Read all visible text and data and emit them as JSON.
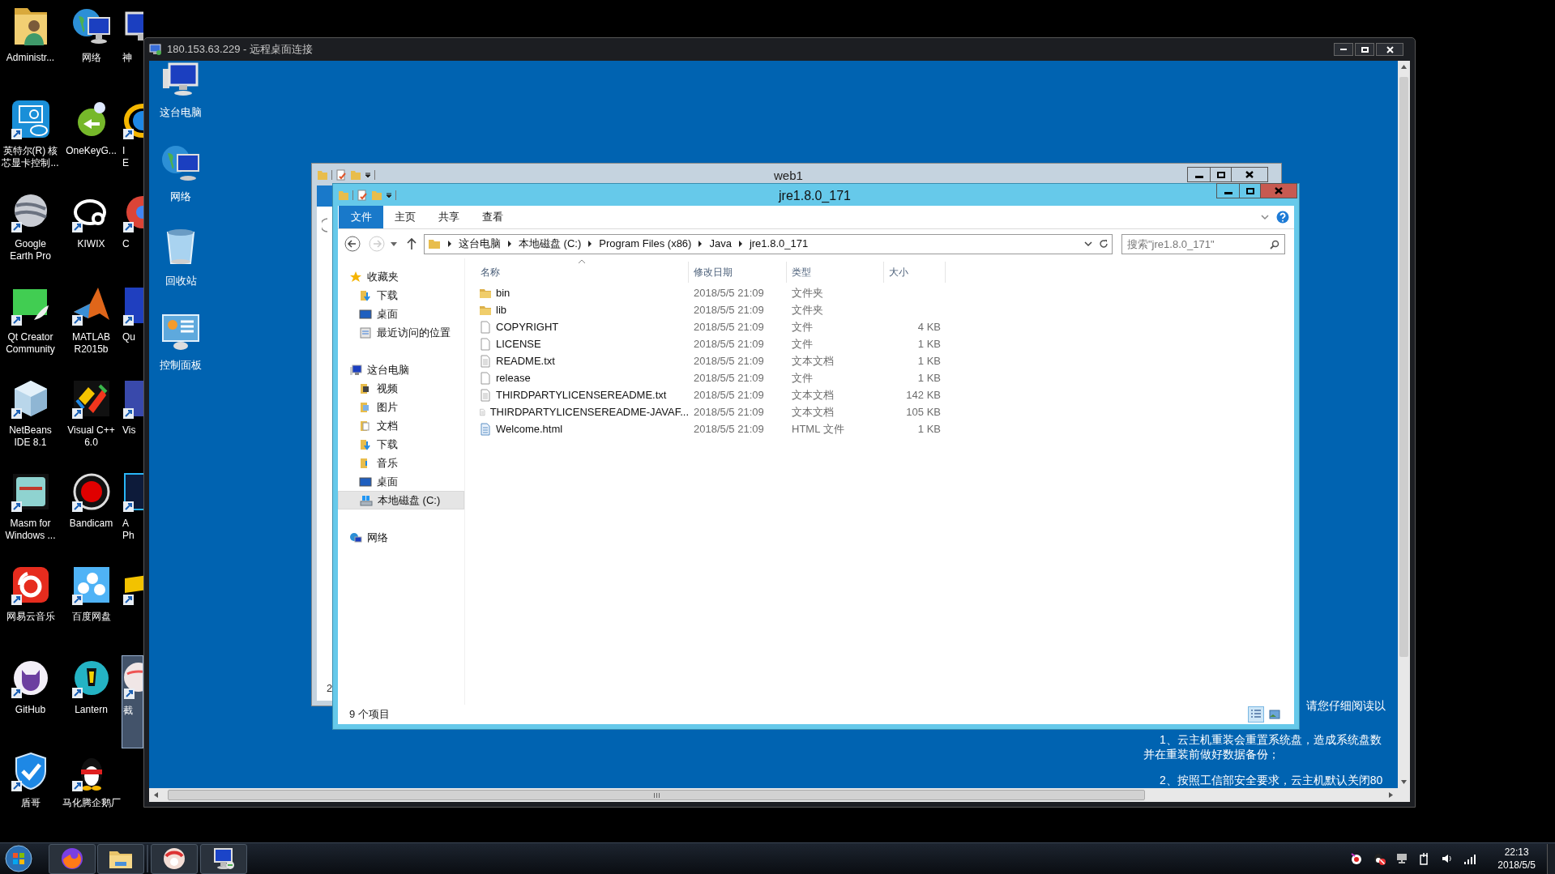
{
  "local_desktop": {
    "icons": [
      {
        "label_lines": [
          "Administr..."
        ],
        "selected": false
      },
      {
        "label_lines": [
          "网络"
        ],
        "selected": false
      },
      {
        "label_lines": [
          "神"
        ],
        "selected": false
      },
      {
        "label_lines": [
          "英特尔(R) 核",
          "芯显卡控制..."
        ],
        "selected": false
      },
      {
        "label_lines": [
          "OneKeyG..."
        ],
        "selected": false
      },
      {
        "label_lines": [
          "I",
          "E"
        ],
        "selected": false
      },
      {
        "label_lines": [
          "Google",
          "Earth Pro"
        ],
        "selected": false
      },
      {
        "label_lines": [
          "KIWIX"
        ],
        "selected": false
      },
      {
        "label_lines": [
          "C"
        ],
        "selected": false
      },
      {
        "label_lines": [
          "Qt Creator",
          "Community"
        ],
        "selected": false
      },
      {
        "label_lines": [
          "MATLAB",
          "R2015b"
        ],
        "selected": false
      },
      {
        "label_lines": [
          "Qu"
        ],
        "selected": false
      },
      {
        "label_lines": [
          "NetBeans",
          "IDE 8.1"
        ],
        "selected": false
      },
      {
        "label_lines": [
          "Visual C++",
          "6.0"
        ],
        "selected": false
      },
      {
        "label_lines": [
          "Vis"
        ],
        "selected": false
      },
      {
        "label_lines": [
          "Masm for",
          "Windows ..."
        ],
        "selected": false
      },
      {
        "label_lines": [
          "Bandicam"
        ],
        "selected": false
      },
      {
        "label_lines": [
          "A",
          "Ph"
        ],
        "selected": false
      },
      {
        "label_lines": [
          "网易云音乐"
        ],
        "selected": false
      },
      {
        "label_lines": [
          "百度网盘"
        ],
        "selected": false
      },
      {
        "selected": false
      },
      {
        "label_lines": [
          "GitHub"
        ],
        "selected": false
      },
      {
        "label_lines": [
          "Lantern"
        ],
        "selected": false
      },
      {
        "label_lines": [
          "截"
        ],
        "selected": true
      },
      {
        "label_lines": [
          "盾哥"
        ],
        "selected": false
      },
      {
        "label_lines": [
          "马化腾企鹅厂"
        ],
        "selected": false
      }
    ]
  },
  "remote_window": {
    "title": "180.153.63.229 - 远程桌面连接",
    "remote_desktop": {
      "icons": [
        {
          "label": "这台电脑",
          "selected": false
        },
        {
          "label": "网络",
          "selected": false
        },
        {
          "label": "回收站",
          "selected": false
        },
        {
          "label": "控制面板",
          "selected": false
        }
      ],
      "notice": [
        "请您仔细阅读以",
        "1、云主机重装会重置系统盘，造成系统盘数",
        "并在重装前做好数据备份；",
        "2、按照工信部安全要求，云主机默认关闭80"
      ]
    },
    "back_window": {
      "title": "web1",
      "status": "2"
    },
    "explorer": {
      "title": "jre1.8.0_171",
      "ribbon_tabs": [
        {
          "label": "文件",
          "selected": true
        },
        {
          "label": "主页",
          "selected": false
        },
        {
          "label": "共享",
          "selected": false
        },
        {
          "label": "查看",
          "selected": false
        }
      ],
      "breadcrumb": [
        "这台电脑",
        "本地磁盘 (C:)",
        "Program Files (x86)",
        "Java",
        "jre1.8.0_171"
      ],
      "search": {
        "placeholder": "搜索\"jre1.8.0_171\""
      },
      "navigation": [
        {
          "label": "收藏夹",
          "kind": "favorites",
          "selected": false,
          "children": [
            {
              "label": "下载",
              "kind": "downloads",
              "selected": false
            },
            {
              "label": "桌面",
              "kind": "desktop",
              "selected": false
            },
            {
              "label": "最近访问的位置",
              "kind": "recent",
              "selected": false
            }
          ]
        },
        {
          "label": "这台电脑",
          "kind": "computer",
          "selected": false,
          "children": [
            {
              "label": "视频",
              "kind": "videos",
              "selected": false
            },
            {
              "label": "图片",
              "kind": "pictures",
              "selected": false
            },
            {
              "label": "文档",
              "kind": "documents",
              "selected": false
            },
            {
              "label": "下载",
              "kind": "downloads",
              "selected": false
            },
            {
              "label": "音乐",
              "kind": "music",
              "selected": false
            },
            {
              "label": "桌面",
              "kind": "desktop",
              "selected": false
            },
            {
              "label": "本地磁盘 (C:)",
              "kind": "drive",
              "selected": true
            }
          ]
        },
        {
          "label": "网络",
          "kind": "network",
          "selected": false
        }
      ],
      "columns": [
        "名称",
        "修改日期",
        "类型",
        "大小"
      ],
      "files": [
        {
          "name": "bin",
          "modified": "2018/5/5 21:09",
          "type": "文件夹",
          "kind": "folder"
        },
        {
          "name": "lib",
          "modified": "2018/5/5 21:09",
          "type": "文件夹",
          "kind": "folder"
        },
        {
          "name": "COPYRIGHT",
          "modified": "2018/5/5 21:09",
          "type": "文件",
          "size": "4 KB",
          "kind": "file"
        },
        {
          "name": "LICENSE",
          "modified": "2018/5/5 21:09",
          "type": "文件",
          "size": "1 KB",
          "kind": "file"
        },
        {
          "name": "README.txt",
          "modified": "2018/5/5 21:09",
          "type": "文本文档",
          "size": "1 KB",
          "kind": "text"
        },
        {
          "name": "release",
          "modified": "2018/5/5 21:09",
          "type": "文件",
          "size": "1 KB",
          "kind": "file"
        },
        {
          "name": "THIRDPARTYLICENSEREADME.txt",
          "modified": "2018/5/5 21:09",
          "type": "文本文档",
          "size": "142 KB",
          "kind": "text"
        },
        {
          "name": "THIRDPARTYLICENSEREADME-JAVAF...",
          "modified": "2018/5/5 21:09",
          "type": "文本文档",
          "size": "105 KB",
          "kind": "text"
        },
        {
          "name": "Welcome.html",
          "modified": "2018/5/5 21:09",
          "type": "HTML 文件",
          "size": "1 KB",
          "kind": "html"
        }
      ],
      "status": "9 个项目",
      "views": [
        {
          "kind": "details",
          "selected": true
        },
        {
          "kind": "large_icons",
          "selected": false
        }
      ]
    }
  },
  "taskbar": {
    "clock": {
      "time": "22:13",
      "date": "2018/5/5"
    }
  }
}
